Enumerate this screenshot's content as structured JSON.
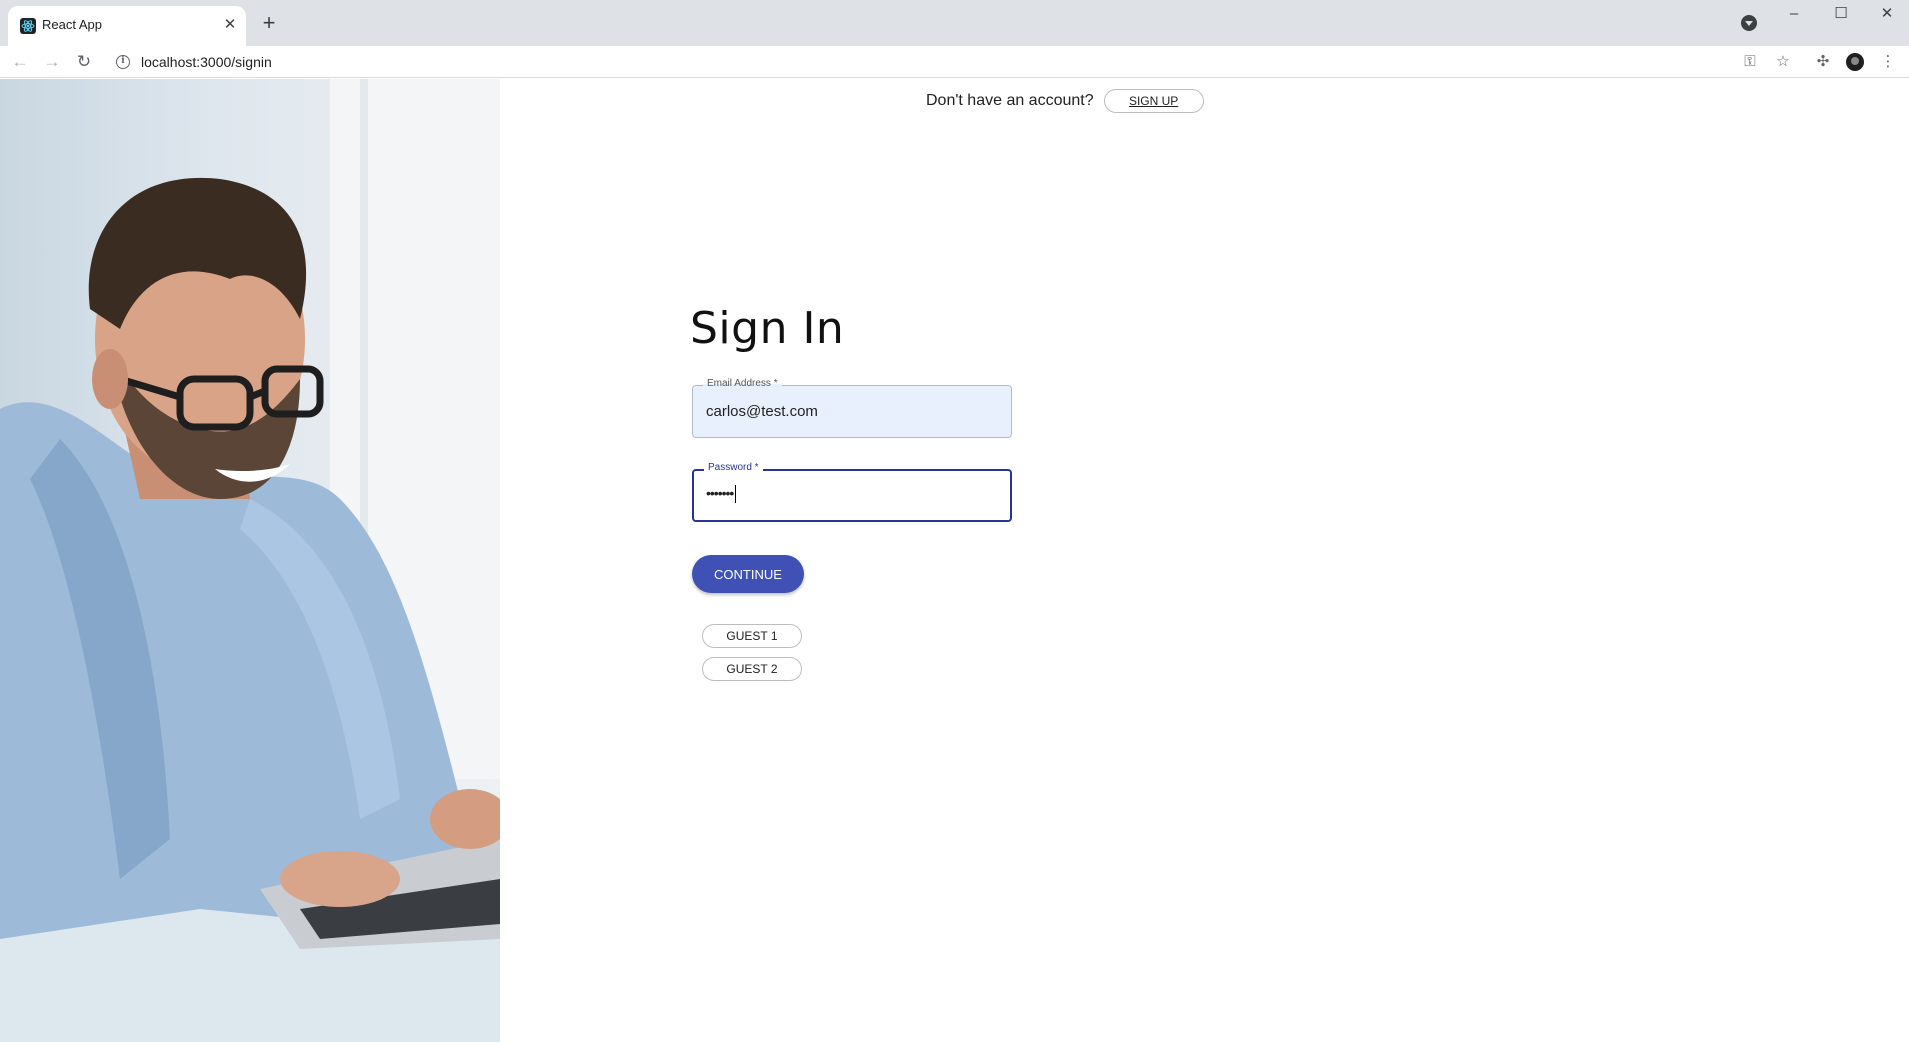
{
  "browser": {
    "tab_title": "React App",
    "url": "localhost:3000/signin"
  },
  "header": {
    "prompt_text": "Don't have an account?",
    "signup_label": "SIGN UP"
  },
  "form": {
    "title": "Sign In",
    "email": {
      "label": "Email Address *",
      "value": "carlos@test.com"
    },
    "password": {
      "label": "Password *",
      "value": "•••••••"
    },
    "continue_label": "CONTINUE"
  },
  "guests": {
    "guest1_label": "GUEST 1",
    "guest2_label": "GUEST 2"
  }
}
